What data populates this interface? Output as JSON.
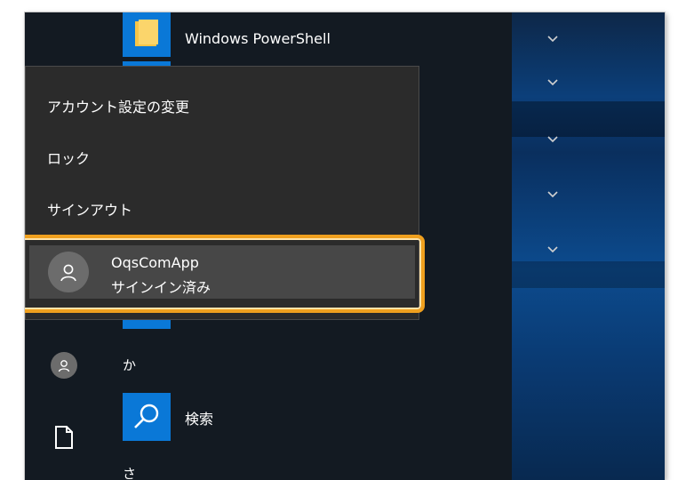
{
  "apps": {
    "powershell_label": "Windows PowerShell",
    "letter_ka": "か",
    "search_label": "検索",
    "letter_sa": "さ"
  },
  "account_menu": {
    "change_settings": "アカウント設定の変更",
    "lock": "ロック",
    "sign_out": "サインアウト",
    "user_name": "OqsComApp",
    "user_status": "サインイン済み"
  },
  "colors": {
    "highlight": "#f0a01e",
    "tile": "#0a78d7",
    "flyout_bg": "#2b2b2b",
    "start_bg": "#131a22"
  },
  "icons": [
    "folder-icon",
    "chevron-down-icon",
    "user-icon",
    "search-icon",
    "document-icon"
  ]
}
